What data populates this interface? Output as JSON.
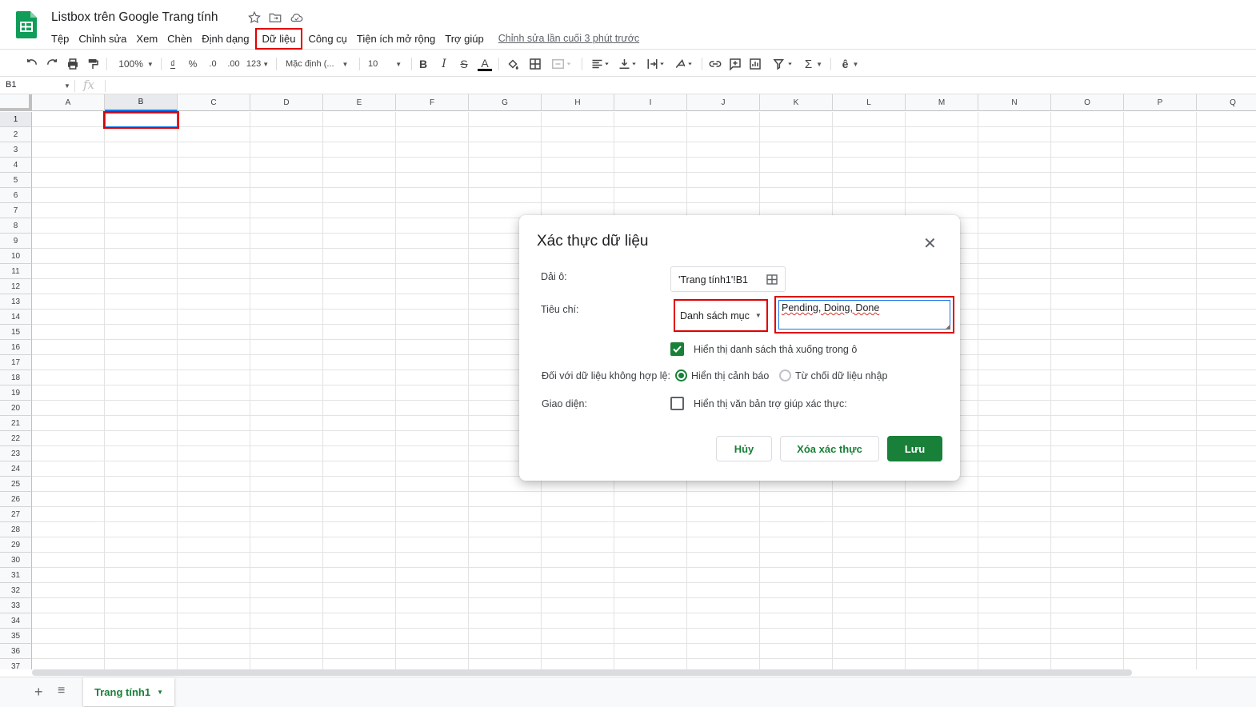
{
  "app": {
    "title": "Listbox trên  Google Trang tính",
    "brand_color": "#0F9D58",
    "accent": "#188038",
    "highlight_color": "#E00000"
  },
  "menu": [
    "Tệp",
    "Chỉnh sửa",
    "Xem",
    "Chèn",
    "Định dạng",
    "Dữ liệu",
    "Công cụ",
    "Tiện ích mở rộng",
    "Trợ giúp"
  ],
  "last_edit": "Chỉnh sửa lần cuối 3 phút trước",
  "toolbar": {
    "zoom": "100%",
    "currency": "₫",
    "percent": "%",
    "decrease_decimal": ".0",
    "increase_decimal": ".00",
    "more_formats": "123",
    "font": "Mặc định (...",
    "font_size": "10",
    "bold": "B",
    "italic": "I",
    "strike": "S",
    "text_color": "A",
    "sum": "Σ",
    "input_tools": "ê"
  },
  "formula_bar": {
    "name_box": "B1",
    "fx": "fx",
    "value": ""
  },
  "grid": {
    "columns": [
      "A",
      "B",
      "C",
      "D",
      "E",
      "F",
      "G",
      "H",
      "I",
      "J",
      "K",
      "L",
      "M",
      "N",
      "O",
      "P",
      "Q"
    ],
    "rows": [
      "1",
      "2",
      "3",
      "4",
      "5",
      "6",
      "7",
      "8",
      "9",
      "10",
      "11",
      "12",
      "13",
      "14",
      "15",
      "16",
      "17",
      "18",
      "19",
      "20",
      "21",
      "22",
      "23",
      "24",
      "25",
      "26",
      "27",
      "28",
      "29",
      "30",
      "31",
      "32",
      "33",
      "34",
      "35",
      "36",
      "37"
    ],
    "selected_cell": "B1"
  },
  "sheets": {
    "active": "Trang tính1",
    "add_icon": "plus-icon",
    "list_icon": "list-icon"
  },
  "dialog": {
    "title": "Xác thực dữ liệu",
    "close_icon": "close-icon",
    "range_label": "Dải ô:",
    "range_value": "'Trang tính1'!B1",
    "criteria_label": "Tiêu chí:",
    "criteria_value": "Danh sách mục",
    "items_value": "Pending, Doing, Done",
    "show_dropdown": {
      "label": "Hiển thị danh sách thả xuống trong ô",
      "checked": true
    },
    "invalid_label": "Đối với dữ liệu không hợp lệ:",
    "invalid_options": [
      {
        "label": "Hiển thị cảnh báo",
        "selected": true
      },
      {
        "label": "Từ chối dữ liệu nhập",
        "selected": false
      }
    ],
    "appearance_label": "Giao diện:",
    "help_text": {
      "label": "Hiển thị văn bản trợ giúp xác thực:",
      "checked": false
    },
    "buttons": {
      "cancel": "Hủy",
      "remove": "Xóa xác thực",
      "save": "Lưu"
    }
  }
}
